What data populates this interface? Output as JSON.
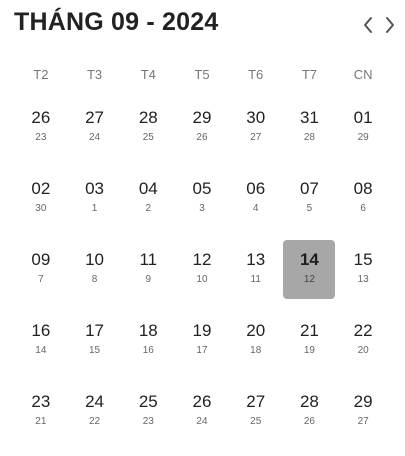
{
  "header": {
    "title": "THÁNG 09 - 2024",
    "prev_icon": "chevron-left-icon",
    "next_icon": "chevron-right-icon"
  },
  "weekdays": [
    "T2",
    "T3",
    "T4",
    "T5",
    "T6",
    "T7",
    "CN"
  ],
  "selected_day": "14",
  "weeks": [
    [
      {
        "day": "26",
        "lunar": "23"
      },
      {
        "day": "27",
        "lunar": "24"
      },
      {
        "day": "28",
        "lunar": "25"
      },
      {
        "day": "29",
        "lunar": "26"
      },
      {
        "day": "30",
        "lunar": "27"
      },
      {
        "day": "31",
        "lunar": "28"
      },
      {
        "day": "01",
        "lunar": "29"
      }
    ],
    [
      {
        "day": "02",
        "lunar": "30"
      },
      {
        "day": "03",
        "lunar": "1"
      },
      {
        "day": "04",
        "lunar": "2"
      },
      {
        "day": "05",
        "lunar": "3"
      },
      {
        "day": "06",
        "lunar": "4"
      },
      {
        "day": "07",
        "lunar": "5"
      },
      {
        "day": "08",
        "lunar": "6"
      }
    ],
    [
      {
        "day": "09",
        "lunar": "7"
      },
      {
        "day": "10",
        "lunar": "8"
      },
      {
        "day": "11",
        "lunar": "9"
      },
      {
        "day": "12",
        "lunar": "10"
      },
      {
        "day": "13",
        "lunar": "11"
      },
      {
        "day": "14",
        "lunar": "12",
        "selected": true
      },
      {
        "day": "15",
        "lunar": "13"
      }
    ],
    [
      {
        "day": "16",
        "lunar": "14"
      },
      {
        "day": "17",
        "lunar": "15"
      },
      {
        "day": "18",
        "lunar": "16"
      },
      {
        "day": "19",
        "lunar": "17"
      },
      {
        "day": "20",
        "lunar": "18"
      },
      {
        "day": "21",
        "lunar": "19"
      },
      {
        "day": "22",
        "lunar": "20"
      }
    ],
    [
      {
        "day": "23",
        "lunar": "21"
      },
      {
        "day": "24",
        "lunar": "22"
      },
      {
        "day": "25",
        "lunar": "23"
      },
      {
        "day": "26",
        "lunar": "24"
      },
      {
        "day": "27",
        "lunar": "25"
      },
      {
        "day": "28",
        "lunar": "26"
      },
      {
        "day": "29",
        "lunar": "27"
      }
    ]
  ],
  "colors": {
    "selected_background": "#a7a7a7",
    "text": "#222222",
    "weekday_text": "#777777",
    "lunar_text": "#666666"
  }
}
